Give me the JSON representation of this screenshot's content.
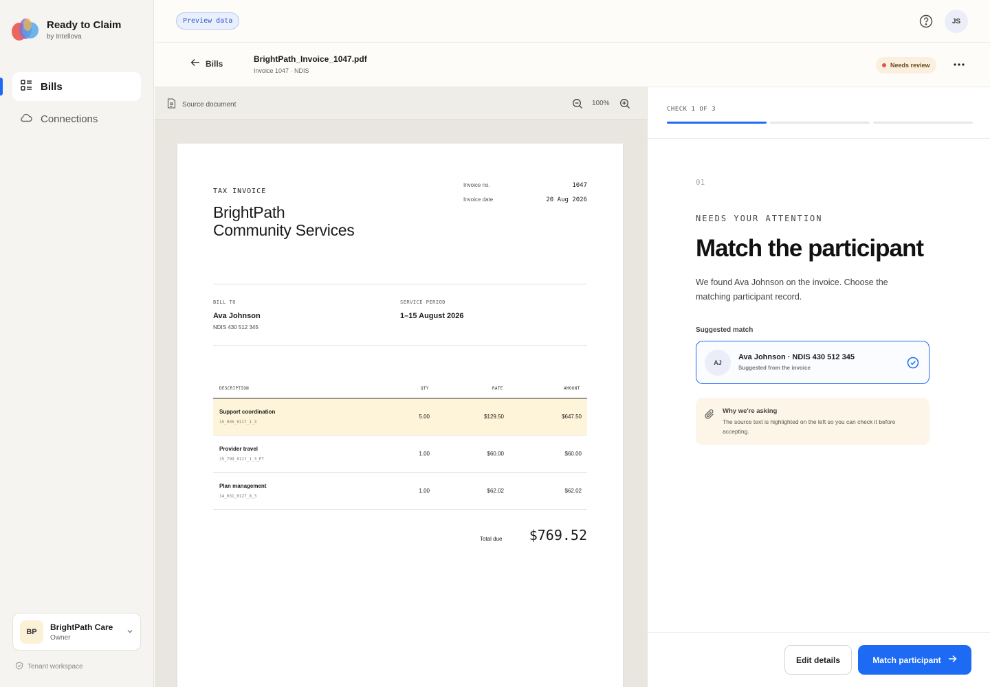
{
  "brand": {
    "title": "Ready to Claim",
    "subtitle": "by Intellova"
  },
  "sidebar": {
    "items": [
      {
        "label": "Bills",
        "icon": "list-icon",
        "active": true
      },
      {
        "label": "Connections",
        "icon": "cloud-icon",
        "active": false
      }
    ],
    "org": {
      "initials": "BP",
      "name": "BrightPath Care",
      "role": "Owner"
    },
    "tenant": "Tenant workspace"
  },
  "topbar": {
    "preview": "Preview data",
    "user_initials": "JS"
  },
  "file": {
    "back_label": "Bills",
    "name": "BrightPath_Invoice_1047.pdf",
    "sub": "Invoice 1047 · NDIS",
    "status": "Needs review"
  },
  "viewer": {
    "source_label": "Source document",
    "zoom": "100%"
  },
  "invoice": {
    "label": "TAX INVOICE",
    "org_line1": "BrightPath",
    "org_line2": "Community Services",
    "number_label": "Invoice no.",
    "number": "1047",
    "date_label": "Invoice date",
    "date": "20 Aug 2026",
    "bill_to_label": "BILL TO",
    "bill_to_name": "Ava Johnson",
    "bill_to_sub": "NDIS 430 512 345",
    "period_label": "SERVICE PERIOD",
    "period": "1–15 August 2026",
    "columns": [
      "DESCRIPTION",
      "QTY",
      "RATE",
      "AMOUNT"
    ],
    "rows": [
      {
        "desc": "Support coordination",
        "code": "15_035_0117_1_3",
        "qty": "5.00",
        "rate": "$129.50",
        "amount": "$647.50"
      },
      {
        "desc": "Provider travel",
        "code": "15_799_0117_1_3_PT",
        "qty": "1.00",
        "rate": "$60.00",
        "amount": "$60.00"
      },
      {
        "desc": "Plan management",
        "code": "14_031_0127_8_3",
        "qty": "1.00",
        "rate": "$62.02",
        "amount": "$62.02"
      }
    ],
    "total_label": "Total due",
    "total": "$769.52"
  },
  "panel": {
    "check_label": "CHECK 1 OF 3",
    "step_no": "01",
    "attention": "NEEDS YOUR ATTENTION",
    "title": "Match the participant",
    "description": "We found Ava Johnson on the invoice. Choose the matching participant record.",
    "suggested_label": "Suggested match",
    "match": {
      "initials": "AJ",
      "name": "Ava Johnson · NDIS 430 512 345",
      "sub": "Suggested from the invoice"
    },
    "why_title": "Why we're asking",
    "why_text": "The source text is highlighted on the left so you can check it before accepting.",
    "edit_label": "Edit details",
    "primary_label": "Match participant"
  },
  "colors": {
    "accent": "#1d6af5",
    "highlight": "#fdf4d9",
    "status_dot": "#e0534f"
  }
}
